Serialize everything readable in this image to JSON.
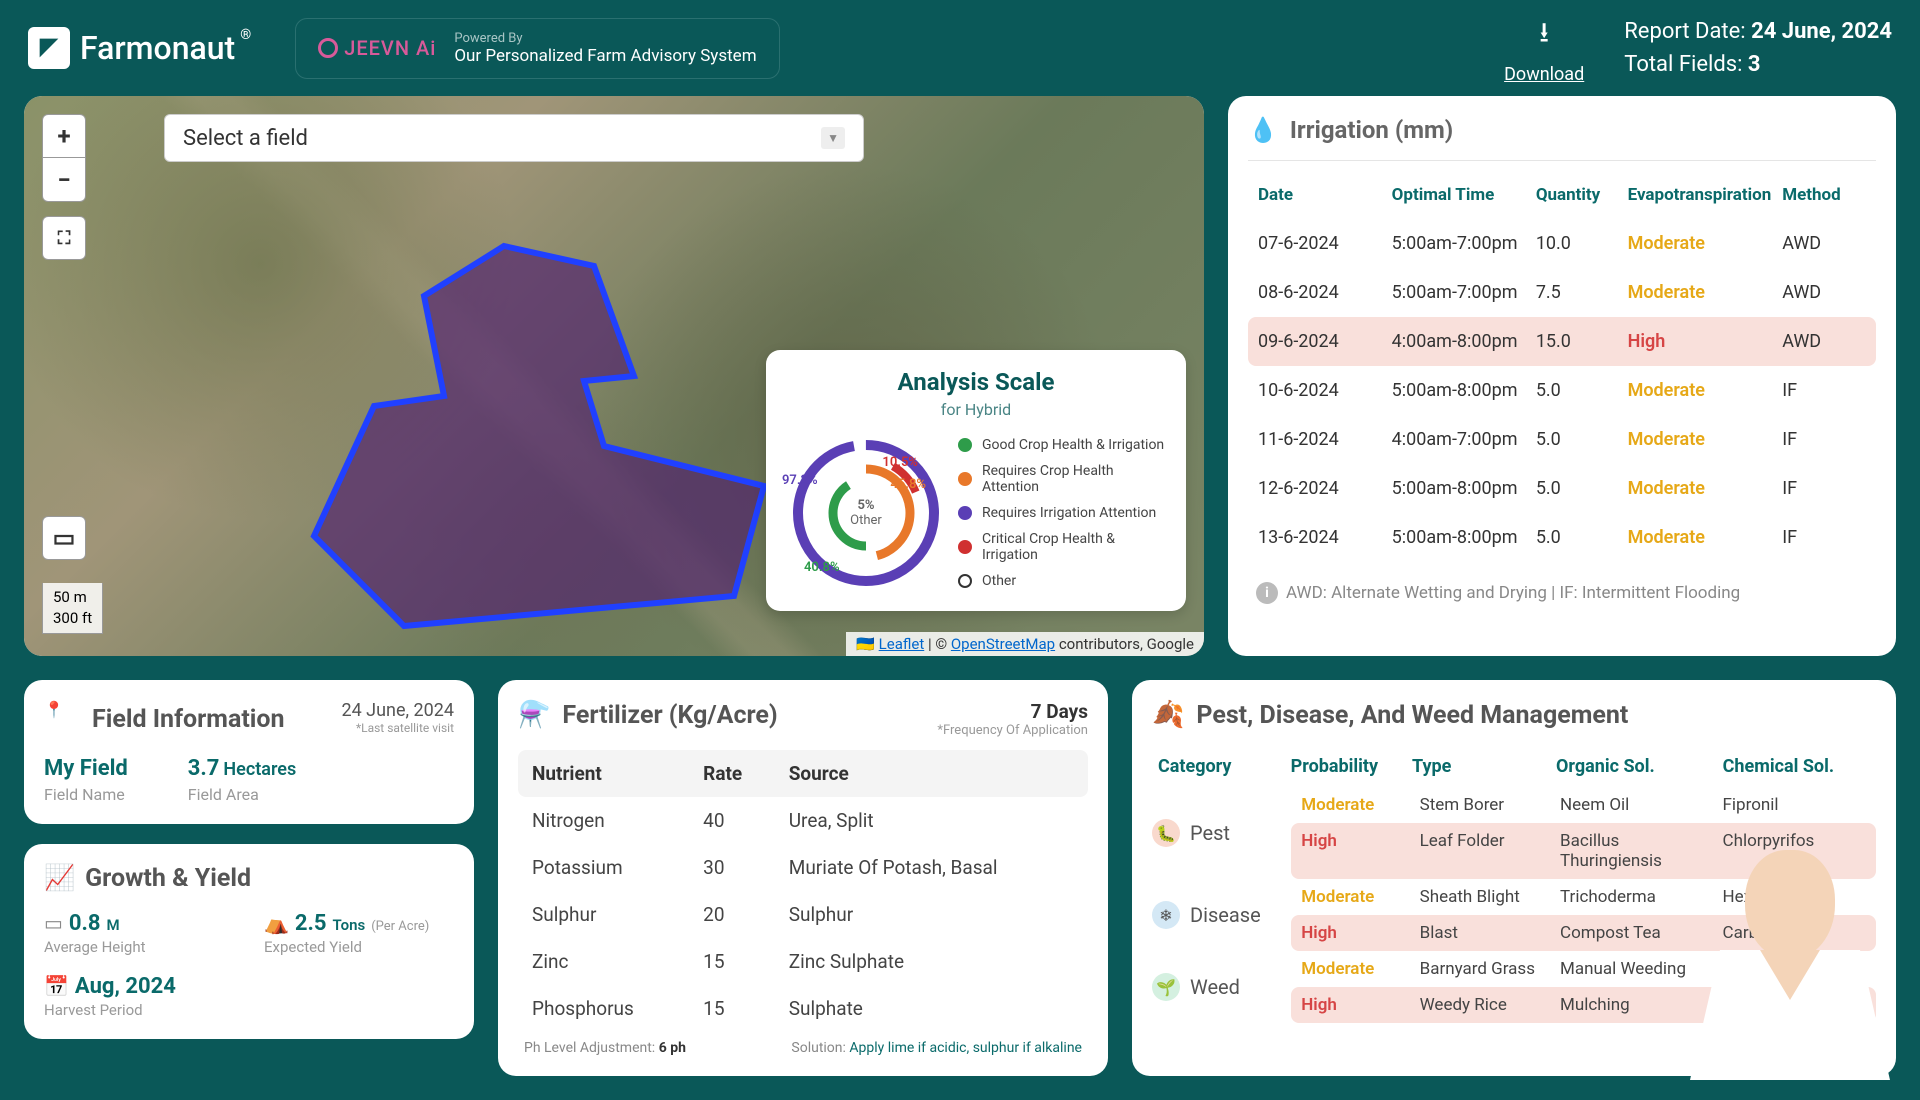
{
  "header": {
    "logo_text": "Farmonaut",
    "jeevn_brand": "JEEVN Ai",
    "jeevn_powered": "Powered By",
    "jeevn_desc": "Our Personalized Farm Advisory System",
    "download_label": "Download",
    "report_date_label": "Report Date:",
    "report_date": "24 June, 2024",
    "total_fields_label": "Total Fields:",
    "total_fields": "3"
  },
  "map": {
    "field_select_placeholder": "Select a field",
    "scale_m": "50 m",
    "scale_ft": "300 ft",
    "attribution_leaflet": "Leaflet",
    "attribution_osm": "OpenStreetMap",
    "attribution_rest": " contributors, Google",
    "analysis": {
      "title": "Analysis Scale",
      "subtitle": "for Hybrid",
      "center_pct": "5%",
      "center_label": "Other",
      "pct1": "97.2%",
      "pct2": "10.5%",
      "pct3": "45.8%",
      "pct4": "40.8%",
      "legend": [
        {
          "color": "#2e9c4a",
          "label": "Good Crop Health & Irrigation"
        },
        {
          "color": "#e8782a",
          "label": "Requires Crop Health Attention"
        },
        {
          "color": "#5a3fb5",
          "label": "Requires Irrigation Attention"
        },
        {
          "color": "#d03030",
          "label": "Critical Crop Health & Irrigation"
        },
        {
          "color": "#ffffff",
          "label": "Other",
          "border": true
        }
      ]
    }
  },
  "irrigation": {
    "title": "Irrigation (mm)",
    "headers": [
      "Date",
      "Optimal Time",
      "Quantity",
      "Evapotranspiration",
      "Method"
    ],
    "rows": [
      {
        "date": "07-6-2024",
        "time": "5:00am-7:00pm",
        "qty": "10.0",
        "evap": "Moderate",
        "method": "AWD",
        "high": false
      },
      {
        "date": "08-6-2024",
        "time": "5:00am-7:00pm",
        "qty": "7.5",
        "evap": "Moderate",
        "method": "AWD",
        "high": false
      },
      {
        "date": "09-6-2024",
        "time": "4:00am-8:00pm",
        "qty": "15.0",
        "evap": "High",
        "method": "AWD",
        "high": true
      },
      {
        "date": "10-6-2024",
        "time": "5:00am-8:00pm",
        "qty": "5.0",
        "evap": "Moderate",
        "method": "IF",
        "high": false
      },
      {
        "date": "11-6-2024",
        "time": "4:00am-7:00pm",
        "qty": "5.0",
        "evap": "Moderate",
        "method": "IF",
        "high": false
      },
      {
        "date": "12-6-2024",
        "time": "5:00am-8:00pm",
        "qty": "5.0",
        "evap": "Moderate",
        "method": "IF",
        "high": false
      },
      {
        "date": "13-6-2024",
        "time": "5:00am-8:00pm",
        "qty": "5.0",
        "evap": "Moderate",
        "method": "IF",
        "high": false
      }
    ],
    "note": "AWD: Alternate Wetting and Drying | IF: Intermittent Flooding"
  },
  "field_info": {
    "title": "Field Information",
    "date": "24 June, 2024",
    "date_sub": "*Last satellite visit",
    "name_val": "My Field",
    "name_label": "Field Name",
    "area_val": "3.7",
    "area_unit": "Hectares",
    "area_label": "Field Area"
  },
  "growth": {
    "title": "Growth & Yield",
    "items": [
      {
        "icon": "height",
        "val": "0.8",
        "unit": "M",
        "label": "Average Height"
      },
      {
        "icon": "yield",
        "val": "2.5",
        "unit": "Tons",
        "unit2": "(Per Acre)",
        "label": "Expected Yield"
      },
      {
        "icon": "calendar",
        "val": "Aug, 2024",
        "unit": "",
        "label": "Harvest Period"
      }
    ]
  },
  "fertilizer": {
    "title": "Fertilizer (Kg/Acre)",
    "freq_val": "7 Days",
    "freq_sub": "*Frequency Of Application",
    "headers": [
      "Nutrient",
      "Rate",
      "Source"
    ],
    "rows": [
      {
        "n": "Nitrogen",
        "r": "40",
        "s": "Urea, Split"
      },
      {
        "n": "Potassium",
        "r": "30",
        "s": "Muriate Of Potash, Basal"
      },
      {
        "n": "Sulphur",
        "r": "20",
        "s": "Sulphur"
      },
      {
        "n": "Zinc",
        "r": "15",
        "s": "Zinc Sulphate"
      },
      {
        "n": "Phosphorus",
        "r": "15",
        "s": "Sulphate"
      }
    ],
    "ph_label": "Ph Level Adjustment:",
    "ph_val": "6 ph",
    "sol_label": "Solution:",
    "sol_val": "Apply lime if acidic, sulphur if alkaline"
  },
  "pest": {
    "title": "Pest, Disease, And Weed Management",
    "headers": [
      "Category",
      "Probability",
      "Type",
      "Organic Sol.",
      "Chemical Sol."
    ],
    "groups": [
      {
        "cat": "Pest",
        "icon_bg": "#f9d9cd",
        "icon": "🐛",
        "rows": [
          {
            "prob": "Moderate",
            "type": "Stem Borer",
            "org": "Neem Oil",
            "chem": "Fipronil",
            "high": false
          },
          {
            "prob": "High",
            "type": "Leaf Folder",
            "org": "Bacillus Thuringiensis",
            "chem": "Chlorpyrifos",
            "high": true
          }
        ]
      },
      {
        "cat": "Disease",
        "icon_bg": "#d4e8f5",
        "icon": "❄",
        "rows": [
          {
            "prob": "Moderate",
            "type": "Sheath Blight",
            "org": "Trichoderma",
            "chem": "Hexaconazole",
            "high": false
          },
          {
            "prob": "High",
            "type": "Blast",
            "org": "Compost Tea",
            "chem": "Carbendazim",
            "high": true
          }
        ]
      },
      {
        "cat": "Weed",
        "icon_bg": "#d4f0e0",
        "icon": "🌱",
        "rows": [
          {
            "prob": "Moderate",
            "type": "Barnyard Grass",
            "org": "Manual Weeding",
            "chem": "",
            "high": false
          },
          {
            "prob": "High",
            "type": "Weedy Rice",
            "org": "Mulching",
            "chem": "",
            "high": true
          }
        ]
      }
    ]
  }
}
